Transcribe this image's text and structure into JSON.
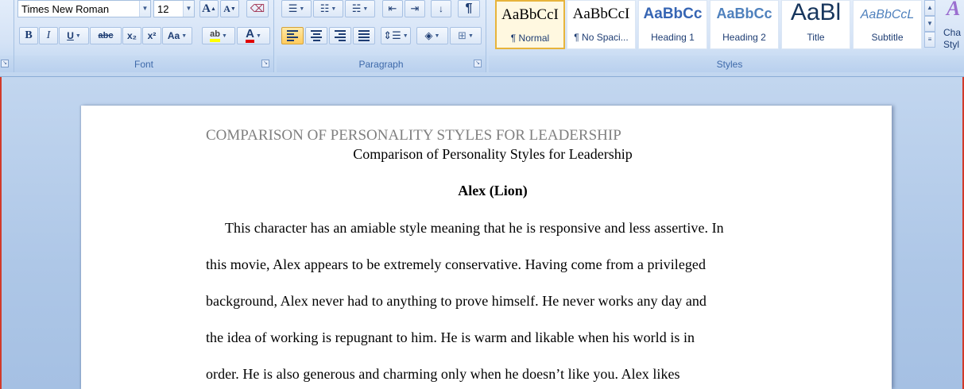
{
  "ribbon": {
    "font": {
      "group_label": "Font",
      "font_name": "Times New Roman",
      "font_size": "12",
      "bold": "B",
      "italic": "I",
      "underline": "U",
      "strikethrough": "abc",
      "subscript": "x₂",
      "superscript": "x²",
      "change_case": "Aa",
      "grow": "A",
      "shrink": "A",
      "highlight": "ab",
      "font_color": "A"
    },
    "paragraph": {
      "group_label": "Paragraph"
    },
    "styles": {
      "group_label": "Styles",
      "items": [
        {
          "sample": "AaBbCcI",
          "name": "¶ Normal"
        },
        {
          "sample": "AaBbCcI",
          "name": "¶ No Spaci..."
        },
        {
          "sample": "AaBbCc",
          "name": "Heading 1"
        },
        {
          "sample": "AaBbCc",
          "name": "Heading 2"
        },
        {
          "sample": "AaBl",
          "name": "Title"
        },
        {
          "sample": "AaBbCcL",
          "name": "Subtitle"
        }
      ],
      "change_styles": "Cha Styl"
    }
  },
  "document": {
    "header": "COMPARISON OF PERSONALITY STYLES FOR LEADERSHIP",
    "title": "Comparison of Personality Styles for Leadership",
    "subheading": "Alex (Lion)",
    "lines": [
      "This character has an amiable style meaning that he is responsive and less assertive. In",
      "this movie, Alex appears to be extremely conservative. Having come from a privileged",
      "background, Alex never had to anything to prove himself. He never works any day and",
      "the idea of working is repugnant to him. He is warm and likable when his world is in",
      "order. He is also generous and charming only when he doesn’t like you. Alex likes"
    ]
  }
}
